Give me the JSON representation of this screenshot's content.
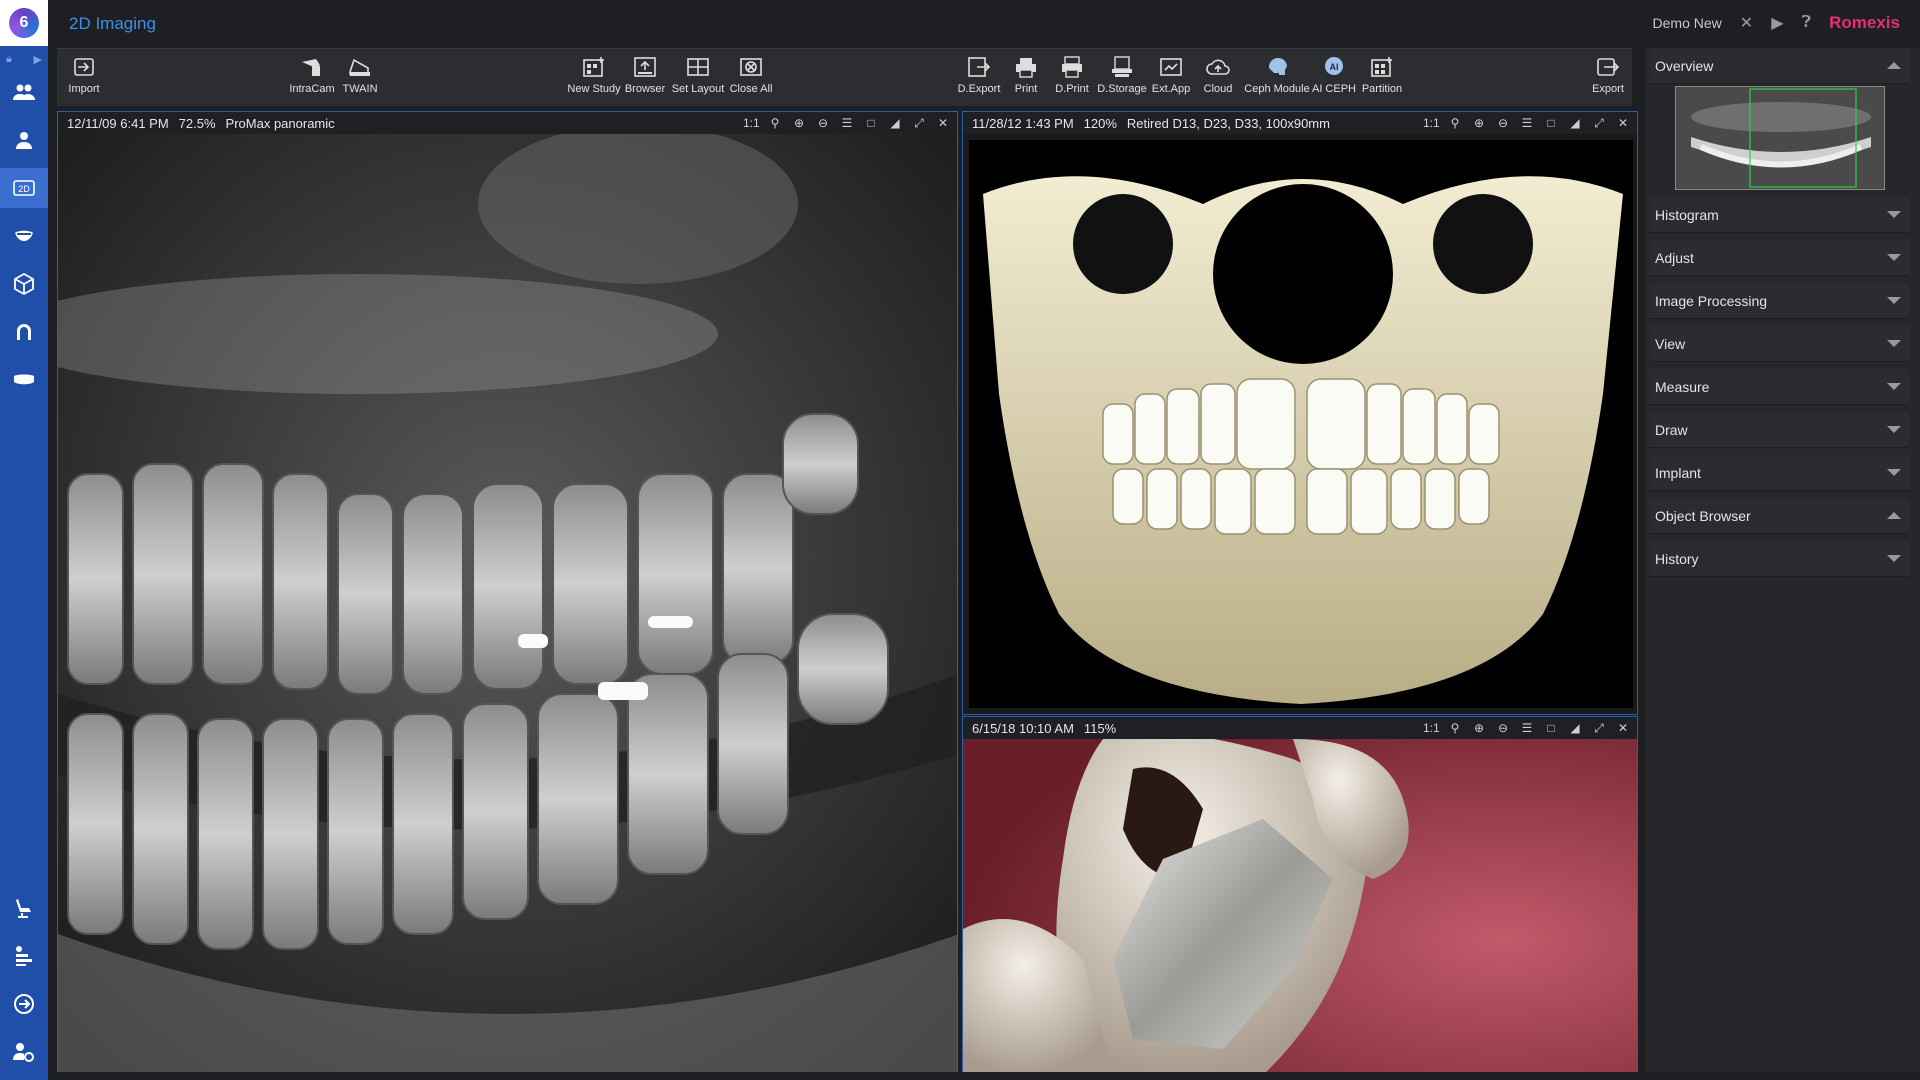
{
  "app": {
    "title": "2D Imaging",
    "user": "Demo New",
    "brand": "Romexis",
    "logo_glyph": "6"
  },
  "rail": {
    "items": [
      {
        "icon": "patients-icon"
      },
      {
        "icon": "patient-icon"
      },
      {
        "icon": "2d-imaging-icon",
        "label": "2D",
        "active": true
      },
      {
        "icon": "dental-icon"
      },
      {
        "icon": "3d-cube-icon"
      },
      {
        "icon": "arch-icon"
      },
      {
        "icon": "model-icon"
      },
      {
        "icon": "chair-icon"
      },
      {
        "icon": "workflow-icon"
      },
      {
        "icon": "logout-icon"
      },
      {
        "icon": "settings-users-icon"
      }
    ]
  },
  "toolbar": {
    "tools": [
      {
        "label": "Import"
      },
      {
        "label": "IntraCam"
      },
      {
        "label": "TWAIN"
      },
      {
        "label": "New Study"
      },
      {
        "label": "Browser"
      },
      {
        "label": "Set Layout"
      },
      {
        "label": "Close All"
      },
      {
        "label": "D.Export"
      },
      {
        "label": "Print"
      },
      {
        "label": "D.Print"
      },
      {
        "label": "D.Storage"
      },
      {
        "label": "Ext.App"
      },
      {
        "label": "Cloud"
      },
      {
        "label": "Ceph Module"
      },
      {
        "label": "AI CEPH"
      },
      {
        "label": "Partition"
      },
      {
        "label": "Export"
      }
    ]
  },
  "viewers": {
    "pano": {
      "date": "12/11/09 6:41 PM",
      "zoom": "72.5%",
      "desc": "ProMax panoramic"
    },
    "skull": {
      "date": "11/28/12 1:43 PM",
      "zoom": "120%",
      "desc": "Retired D13, D23, D33, 100x90mm"
    },
    "intra": {
      "date": "6/15/18 10:10 AM",
      "zoom": "115%",
      "desc": ""
    },
    "tools": {
      "ratio": "1:1"
    }
  },
  "panel": {
    "sections": [
      {
        "label": "Overview",
        "state": "up"
      },
      {
        "label": "Histogram",
        "state": "down"
      },
      {
        "label": "Adjust",
        "state": "down"
      },
      {
        "label": "Image Processing",
        "state": "down"
      },
      {
        "label": "View",
        "state": "down"
      },
      {
        "label": "Measure",
        "state": "down"
      },
      {
        "label": "Draw",
        "state": "down"
      },
      {
        "label": "Implant",
        "state": "down"
      },
      {
        "label": "Object Browser",
        "state": "up"
      },
      {
        "label": "History",
        "state": "down"
      }
    ]
  },
  "colors": {
    "accent": "#3c8fe6",
    "rail": "#1f4fa8",
    "brand": "#e0326e"
  }
}
